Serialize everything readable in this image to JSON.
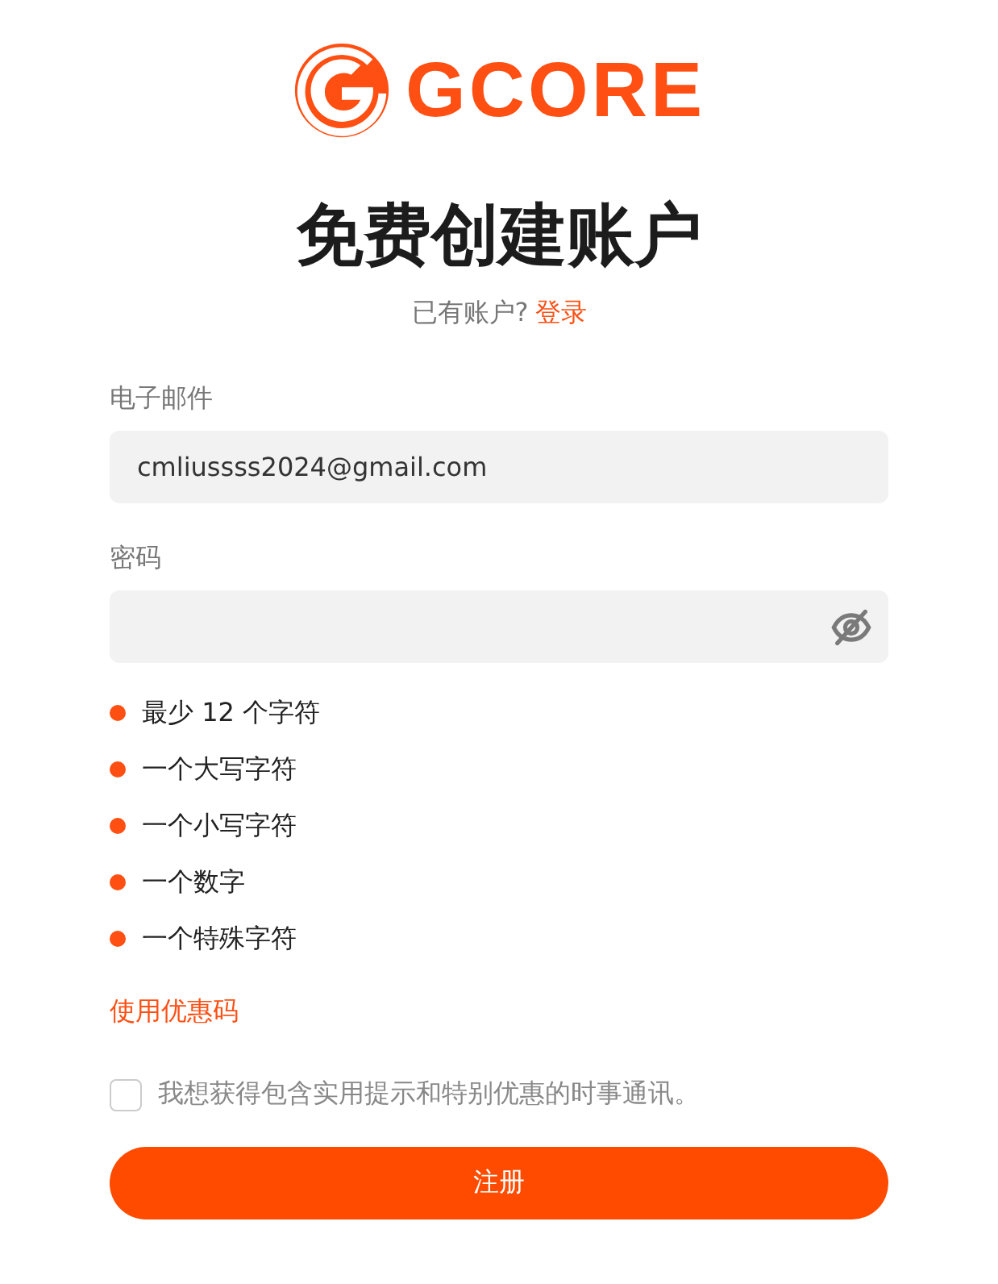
{
  "logo": {
    "text": "GCORE"
  },
  "title": "免费创建账户",
  "login_prompt": {
    "text": "已有账户?",
    "link": "登录"
  },
  "email": {
    "label": "电子邮件",
    "value": "cmliussss2024@gmail.com"
  },
  "password": {
    "label": "密码"
  },
  "requirements": [
    "最少 12 个字符",
    "一个大写字符",
    "一个小写字符",
    "一个数字",
    "一个特殊字符"
  ],
  "promo_link": "使用优惠码",
  "newsletter": {
    "label": "我想获得包含实用提示和特别优惠的时事通讯。",
    "checked": false
  },
  "submit": "注册"
}
